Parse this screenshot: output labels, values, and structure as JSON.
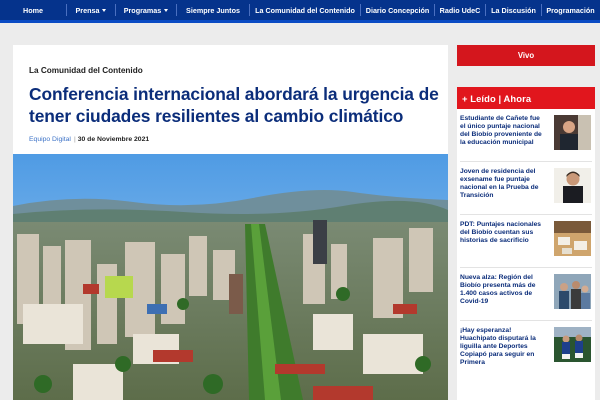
{
  "nav": {
    "items": [
      {
        "label": "Home",
        "dropdown": false
      },
      {
        "label": "Prensa",
        "dropdown": true
      },
      {
        "label": "Programas",
        "dropdown": true
      },
      {
        "label": "Siempre Juntos",
        "dropdown": false
      },
      {
        "label": "La Comunidad del Contenido",
        "dropdown": false
      },
      {
        "label": "Diario Concepción",
        "dropdown": false
      },
      {
        "label": "Radio UdeC",
        "dropdown": false
      },
      {
        "label": "La Discusión",
        "dropdown": false
      },
      {
        "label": "Programación",
        "dropdown": false
      }
    ]
  },
  "article": {
    "section": "La Comunidad del Contenido",
    "title": "Conferencia internacional abordará la urgencia de tener ciudades resilientes al cambio climático",
    "author": "Equipo Digital",
    "separator": "|",
    "date": "30 de Noviembre 2021",
    "image_subject": "aerial-city-photo"
  },
  "sidebar": {
    "vivo_label": "Vivo",
    "header": "+ Leído | Ahora",
    "items": [
      {
        "title": "Estudiante de Cañete fue el único puntaje nacional del Biobío proveniente de la educación municipal",
        "thumb": "student-photo"
      },
      {
        "title": "Joven de residencia del exsename fue puntaje nacional en la Prueba de Transición",
        "thumb": "young-man-photo"
      },
      {
        "title": "PDT: Puntajes nacionales del Biobío cuentan sus historias de sacrificio",
        "thumb": "classroom-photo"
      },
      {
        "title": "Nueva alza: Región del Biobío presenta más de 1.400 casos activos de Covid-19",
        "thumb": "people-photo"
      },
      {
        "title": "¡Hay esperanza! Huachipato disputará la liguilla ante Deportes Copiapó para seguir en Primera",
        "thumb": "football-photo"
      }
    ]
  },
  "colors": {
    "nav_bg": "#05338c",
    "headline": "#0b2d7a",
    "accent_red": "#e1161d",
    "author": "#3d73c7"
  }
}
